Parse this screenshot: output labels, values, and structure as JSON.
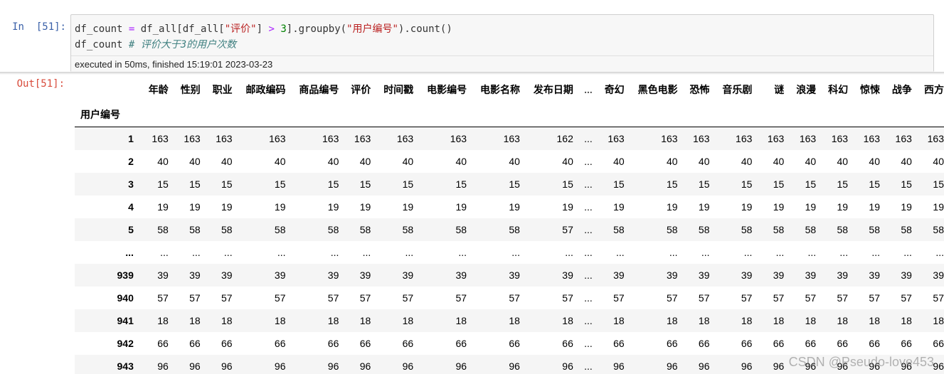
{
  "input_cell": {
    "prompt_label": "In",
    "prompt_number": "[51]:",
    "code": {
      "line1": {
        "a": "df_count ",
        "op1": "=",
        "b": " df_all[df_all[",
        "s1": "\"评价\"",
        "c": "] ",
        "op2": ">",
        "d": " ",
        "n1": "3",
        "e": "].groupby(",
        "s2": "\"用户编号\"",
        "f": ").count()"
      },
      "line2": {
        "a": "df_count ",
        "comment": "# 评价大于3的用户次数"
      }
    },
    "exec_status": "executed in 50ms, finished 15:19:01 2023-03-23"
  },
  "output_cell": {
    "prompt": "Out[51]:",
    "table": {
      "index_name": "用户编号",
      "columns": [
        "年龄",
        "性别",
        "职业",
        "邮政编码",
        "商品编号",
        "评价",
        "时间戳",
        "电影编号",
        "电影名称",
        "发布日期",
        "...",
        "奇幻",
        "黑色电影",
        "恐怖",
        "音乐剧",
        "谜",
        "浪漫",
        "科幻",
        "惊悚",
        "战争",
        "西方"
      ],
      "rows": [
        {
          "index": "1",
          "cells": [
            "163",
            "163",
            "163",
            "163",
            "163",
            "163",
            "163",
            "163",
            "163",
            "162",
            "...",
            "163",
            "163",
            "163",
            "163",
            "163",
            "163",
            "163",
            "163",
            "163",
            "163"
          ]
        },
        {
          "index": "2",
          "cells": [
            "40",
            "40",
            "40",
            "40",
            "40",
            "40",
            "40",
            "40",
            "40",
            "40",
            "...",
            "40",
            "40",
            "40",
            "40",
            "40",
            "40",
            "40",
            "40",
            "40",
            "40"
          ]
        },
        {
          "index": "3",
          "cells": [
            "15",
            "15",
            "15",
            "15",
            "15",
            "15",
            "15",
            "15",
            "15",
            "15",
            "...",
            "15",
            "15",
            "15",
            "15",
            "15",
            "15",
            "15",
            "15",
            "15",
            "15"
          ]
        },
        {
          "index": "4",
          "cells": [
            "19",
            "19",
            "19",
            "19",
            "19",
            "19",
            "19",
            "19",
            "19",
            "19",
            "...",
            "19",
            "19",
            "19",
            "19",
            "19",
            "19",
            "19",
            "19",
            "19",
            "19"
          ]
        },
        {
          "index": "5",
          "cells": [
            "58",
            "58",
            "58",
            "58",
            "58",
            "58",
            "58",
            "58",
            "58",
            "57",
            "...",
            "58",
            "58",
            "58",
            "58",
            "58",
            "58",
            "58",
            "58",
            "58",
            "58"
          ]
        },
        {
          "index": "...",
          "cells": [
            "...",
            "...",
            "...",
            "...",
            "...",
            "...",
            "...",
            "...",
            "...",
            "...",
            "...",
            "...",
            "...",
            "...",
            "...",
            "...",
            "...",
            "...",
            "...",
            "...",
            "..."
          ]
        },
        {
          "index": "939",
          "cells": [
            "39",
            "39",
            "39",
            "39",
            "39",
            "39",
            "39",
            "39",
            "39",
            "39",
            "...",
            "39",
            "39",
            "39",
            "39",
            "39",
            "39",
            "39",
            "39",
            "39",
            "39"
          ]
        },
        {
          "index": "940",
          "cells": [
            "57",
            "57",
            "57",
            "57",
            "57",
            "57",
            "57",
            "57",
            "57",
            "57",
            "...",
            "57",
            "57",
            "57",
            "57",
            "57",
            "57",
            "57",
            "57",
            "57",
            "57"
          ]
        },
        {
          "index": "941",
          "cells": [
            "18",
            "18",
            "18",
            "18",
            "18",
            "18",
            "18",
            "18",
            "18",
            "18",
            "...",
            "18",
            "18",
            "18",
            "18",
            "18",
            "18",
            "18",
            "18",
            "18",
            "18"
          ]
        },
        {
          "index": "942",
          "cells": [
            "66",
            "66",
            "66",
            "66",
            "66",
            "66",
            "66",
            "66",
            "66",
            "66",
            "...",
            "66",
            "66",
            "66",
            "66",
            "66",
            "66",
            "66",
            "66",
            "66",
            "66"
          ]
        },
        {
          "index": "943",
          "cells": [
            "96",
            "96",
            "96",
            "96",
            "96",
            "96",
            "96",
            "96",
            "96",
            "96",
            "...",
            "96",
            "96",
            "96",
            "96",
            "96",
            "96",
            "96",
            "96",
            "96",
            "96"
          ]
        }
      ]
    }
  },
  "watermark": "CSDN @Pseudo-love453"
}
